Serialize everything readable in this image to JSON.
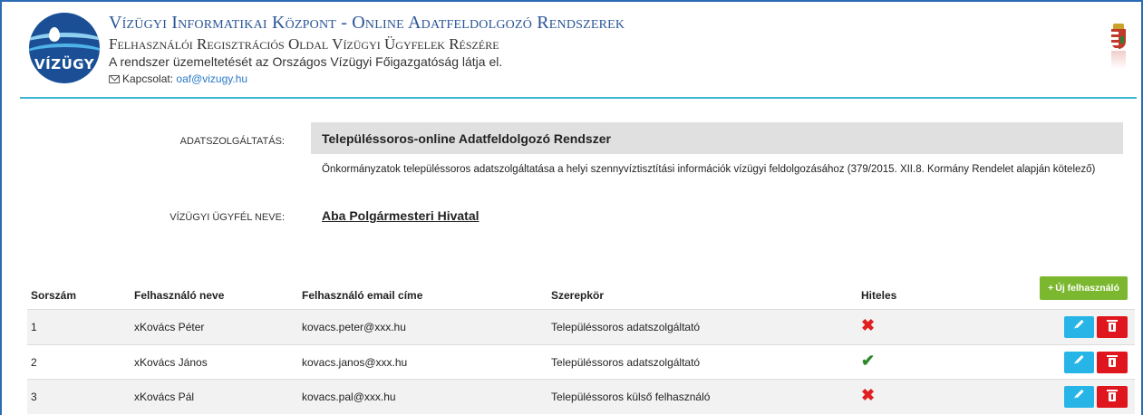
{
  "header": {
    "logo_text": "VÍZÜGY",
    "title": "Vízügyi Informatikai Központ - Online Adatfeldolgozó Rendszerek",
    "subtitle": "Felhasználói Regisztrációs Oldal Vízügyi Ügyfelek Részére",
    "operator": "A rendszer üzemeltetését az Országos Vízügyi Főigazgatóság látja el.",
    "contact_label": "Kapcsolat:",
    "contact_email": "oaf@vizugy.hu"
  },
  "info": {
    "service_label": "Adatszolgáltatás:",
    "service_name": "Településsoros-online Adatfeldolgozó Rendszer",
    "service_description": "Önkormányzatok településsoros adatszolgáltatása a helyi szennyvíztisztítási információk vízügyi feldolgozásához (379/2015. XII.8. Kormány Rendelet alapján kötelező)",
    "client_label": "Vízügyi ügyfél neve:",
    "client_name": "Aba Polgármesteri Hivatal"
  },
  "table": {
    "columns": [
      "Sorszám",
      "Felhasználó neve",
      "Felhasználó email címe",
      "Szerepkör",
      "Hiteles"
    ],
    "add_button_label": "Új felhasználó",
    "rows": [
      {
        "index": "1",
        "name": "xKovács Péter",
        "email": "kovacs.peter@xxx.hu",
        "role": "Településsoros adatszolgáltató",
        "verified": false
      },
      {
        "index": "2",
        "name": "xKovács János",
        "email": "kovacs.janos@xxx.hu",
        "role": "Településsoros adatszolgáltató",
        "verified": true
      },
      {
        "index": "3",
        "name": "xKovács Pál",
        "email": "kovacs.pal@xxx.hu",
        "role": "Településsoros külső felhasználó",
        "verified": false
      }
    ]
  },
  "colors": {
    "brand_blue": "#2a5597",
    "divider": "#3fb6d6",
    "add_button": "#7cb82f",
    "edit_button": "#26b5e6",
    "delete_button": "#e0161e",
    "verified_yes": "#2a8a2a",
    "verified_no": "#e02020"
  },
  "icons": {
    "verified_true": "check-icon",
    "verified_false": "cross-icon",
    "edit": "pencil-icon",
    "delete": "trash-icon",
    "contact": "envelope-icon"
  }
}
